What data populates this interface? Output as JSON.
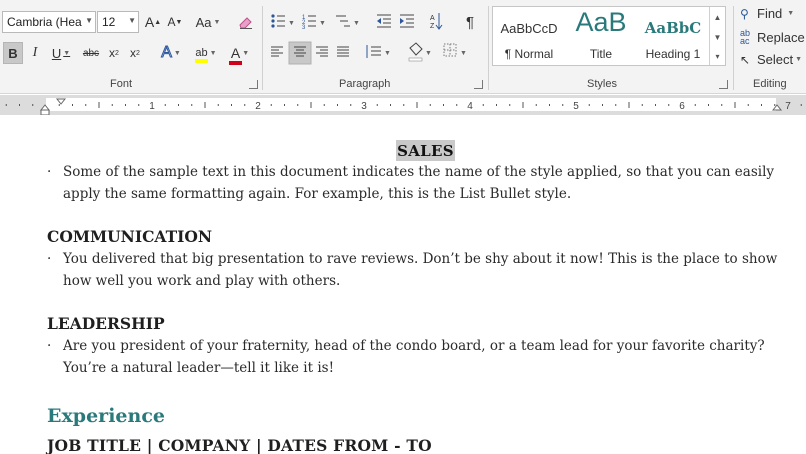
{
  "ribbon": {
    "font_group": {
      "label": "Font",
      "font_name": "Cambria (Hea",
      "font_size": "12",
      "grow_font": "A",
      "shrink_font": "A",
      "change_case": "Aa",
      "bold": "B",
      "italic": "I",
      "underline": "U",
      "strikethrough": "abc",
      "subscript": "x",
      "superscript": "x",
      "text_effects": "A",
      "highlight": "ab",
      "font_color": "A",
      "highlight_color": "#ffff00",
      "font_color_value": "#d0021b"
    },
    "paragraph_group": {
      "label": "Paragraph",
      "show_marks": "¶"
    },
    "styles_group": {
      "label": "Styles",
      "items": [
        {
          "preview": "AaBbCcD",
          "name": "¶ Normal",
          "color": "#333333"
        },
        {
          "preview": "AaB",
          "name": "Title",
          "color": "#2a7a7c"
        },
        {
          "preview": "AaBbC",
          "name": "Heading 1",
          "color": "#2a7a7c"
        }
      ]
    },
    "editing_group": {
      "label": "Editing",
      "find": "Find",
      "replace": "Replace",
      "select": "Select"
    }
  },
  "ruler": {
    "numbers": [
      "1",
      "2",
      "3",
      "4",
      "5",
      "6",
      "7"
    ]
  },
  "document": {
    "sales_heading": "SALES",
    "sections": [
      {
        "bullet": "Some of the sample text in this document indicates the name of the style applied, so that you can easily apply the same formatting again. For example, this is the List Bullet style."
      },
      {
        "heading": "COMMUNICATION",
        "bullet": "You delivered that big presentation to rave reviews. Don’t be shy about it now! This is the place to show how well you work and play with others."
      },
      {
        "heading": "LEADERSHIP",
        "bullet": "Are you president of your fraternity, head of the condo board, or a team lead for your favorite charity? You’re a natural leader—tell it like it is!"
      }
    ],
    "experience_heading": "Experience",
    "job_line": "JOB TITLE | COMPANY | DATES FROM - TO",
    "bullet_char": "·"
  }
}
